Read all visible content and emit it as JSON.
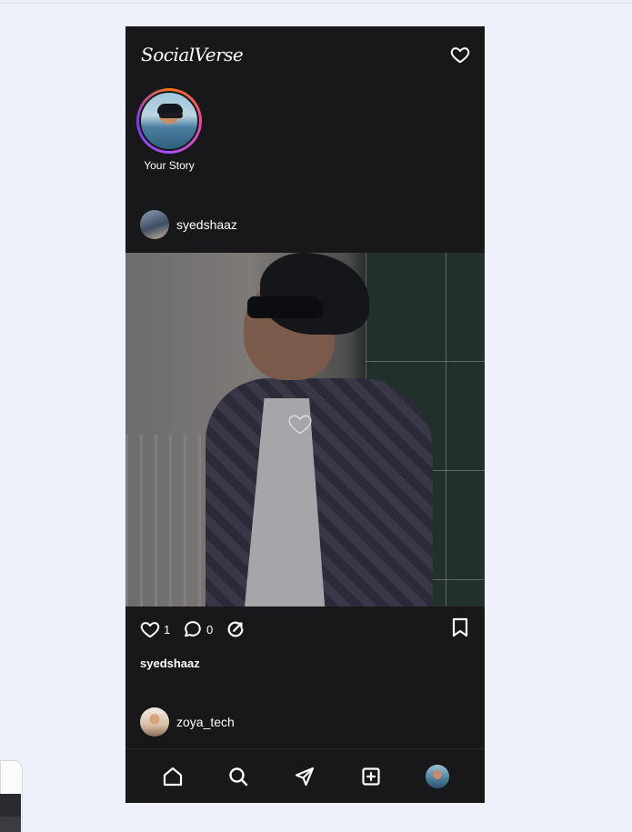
{
  "app": {
    "title": "SocialVerse"
  },
  "stories": [
    {
      "label": "Your Story"
    }
  ],
  "posts": [
    {
      "username": "syedshaaz",
      "likes": "1",
      "comments": "0",
      "caption_user": "syedshaaz"
    },
    {
      "username": "zoya_tech"
    }
  ],
  "icons": {
    "header": "heart-icon",
    "actions": [
      "heart-icon",
      "comment-icon",
      "share-icon",
      "bookmark-icon"
    ],
    "nav": [
      "home-icon",
      "search-icon",
      "send-icon",
      "add-post-icon",
      "profile-avatar"
    ]
  },
  "colors": {
    "page_bg": "#eef1f9",
    "app_bg": "#18181b",
    "text": "#ffffff",
    "story_ring": [
      "#f97316",
      "#ec4899",
      "#a855f7"
    ]
  }
}
